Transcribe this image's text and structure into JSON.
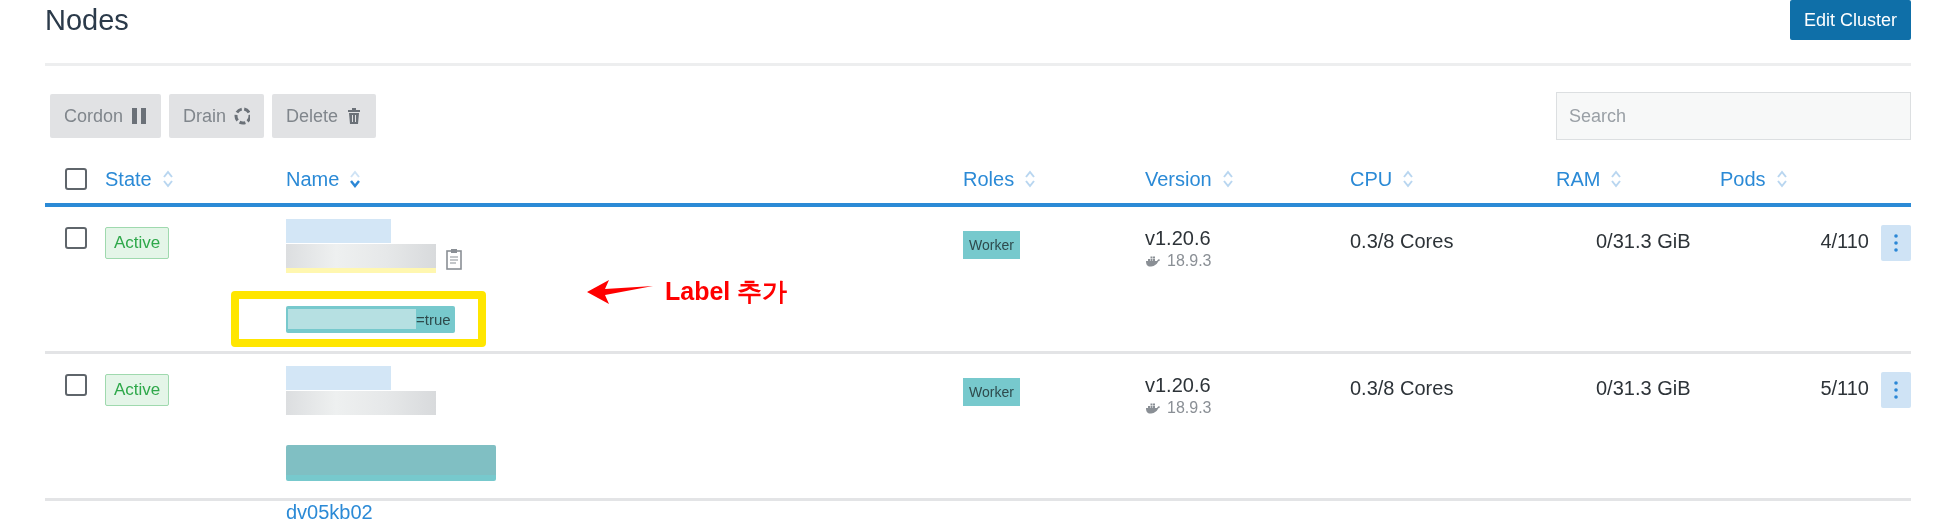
{
  "page": {
    "title": "Nodes",
    "edit_button": "Edit Cluster"
  },
  "bulk_actions": [
    {
      "label": "Cordon",
      "kind": "pause"
    },
    {
      "label": "Drain",
      "kind": "drain"
    },
    {
      "label": "Delete",
      "kind": "trash"
    }
  ],
  "search": {
    "placeholder": "Search"
  },
  "table": {
    "select_all": {
      "checked": false
    },
    "columns": [
      {
        "label": "State",
        "sorted": false
      },
      {
        "label": "Name",
        "sorted": true
      },
      {
        "label": "Roles",
        "sorted": false
      },
      {
        "label": "Version",
        "sorted": false
      },
      {
        "label": "CPU",
        "sorted": false
      },
      {
        "label": "RAM",
        "sorted": false
      },
      {
        "label": "Pods",
        "sorted": false
      }
    ],
    "rows": [
      {
        "checked": false,
        "state": "Active",
        "label": "=true",
        "role": "Worker",
        "version": "v1.20.6",
        "docker": "18.9.3",
        "cpu": "0.3/8 Cores",
        "ram": "0/31.3 GiB",
        "pods": "4/110"
      },
      {
        "checked": false,
        "state": "Active",
        "role": "Worker",
        "version": "v1.20.6",
        "docker": "18.9.3",
        "cpu": "0.3/8 Cores",
        "ram": "0/31.3 GiB",
        "pods": "5/110"
      },
      {
        "name": "dv05kb02"
      }
    ]
  },
  "annotation": {
    "text": "Label 추가"
  }
}
